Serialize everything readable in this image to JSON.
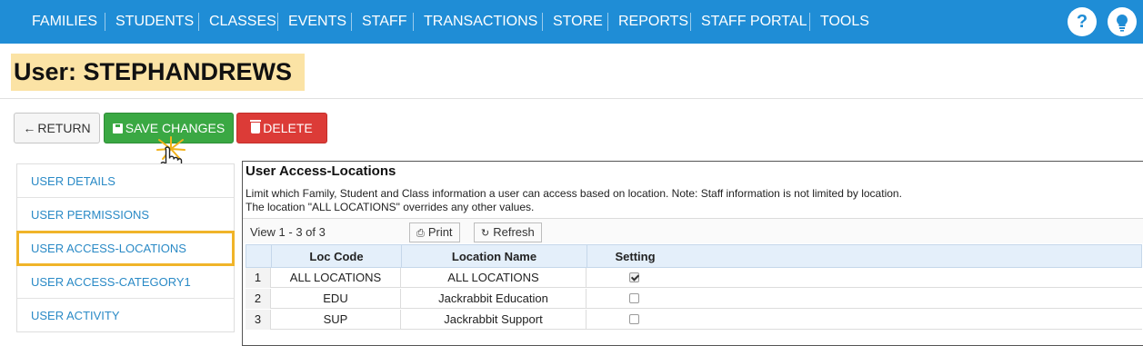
{
  "nav": {
    "items": [
      "FAMILIES",
      "STUDENTS",
      "CLASSES",
      "EVENTS",
      "STAFF",
      "TRANSACTIONS",
      "STORE",
      "REPORTS",
      "STAFF PORTAL",
      "TOOLS"
    ],
    "help_glyph": "?",
    "color": "#1f8dd6"
  },
  "page": {
    "title": "User: STEPHANDREWS"
  },
  "actions": {
    "return_label": "RETURN",
    "save_label": "SAVE CHANGES",
    "delete_label": "DELETE"
  },
  "sidemenu": {
    "items": [
      "USER DETAILS",
      "USER PERMISSIONS",
      "USER ACCESS-LOCATIONS",
      "USER ACCESS-CATEGORY1",
      "USER ACTIVITY"
    ],
    "highlighted": "USER ACCESS-LOCATIONS"
  },
  "panel": {
    "title": "User Access-Locations",
    "desc_line1": "Limit which Family, Student and Class information a user can access based on location. Note: Staff information is not limited by location.",
    "desc_line2": "The location \"ALL LOCATIONS\" overrides any other values.",
    "view_count": "View 1 - 3 of 3",
    "print_label": "Print",
    "refresh_label": "Refresh"
  },
  "grid": {
    "headers": [
      "Loc Code",
      "Location Name",
      "Setting"
    ],
    "rows": [
      {
        "num": "1",
        "code": "ALL LOCATIONS",
        "name": "ALL LOCATIONS",
        "setting": true
      },
      {
        "num": "2",
        "code": "EDU",
        "name": "Jackrabbit Education",
        "setting": false
      },
      {
        "num": "3",
        "code": "SUP",
        "name": "Jackrabbit Support",
        "setting": false
      }
    ]
  },
  "icons": {
    "help": "help-icon",
    "idea": "lightbulb-icon",
    "return": "arrow-left-icon",
    "save": "save-icon",
    "delete": "trash-icon",
    "print": "print-icon",
    "refresh": "refresh-icon",
    "cursor": "pointer-hand-cursor"
  }
}
